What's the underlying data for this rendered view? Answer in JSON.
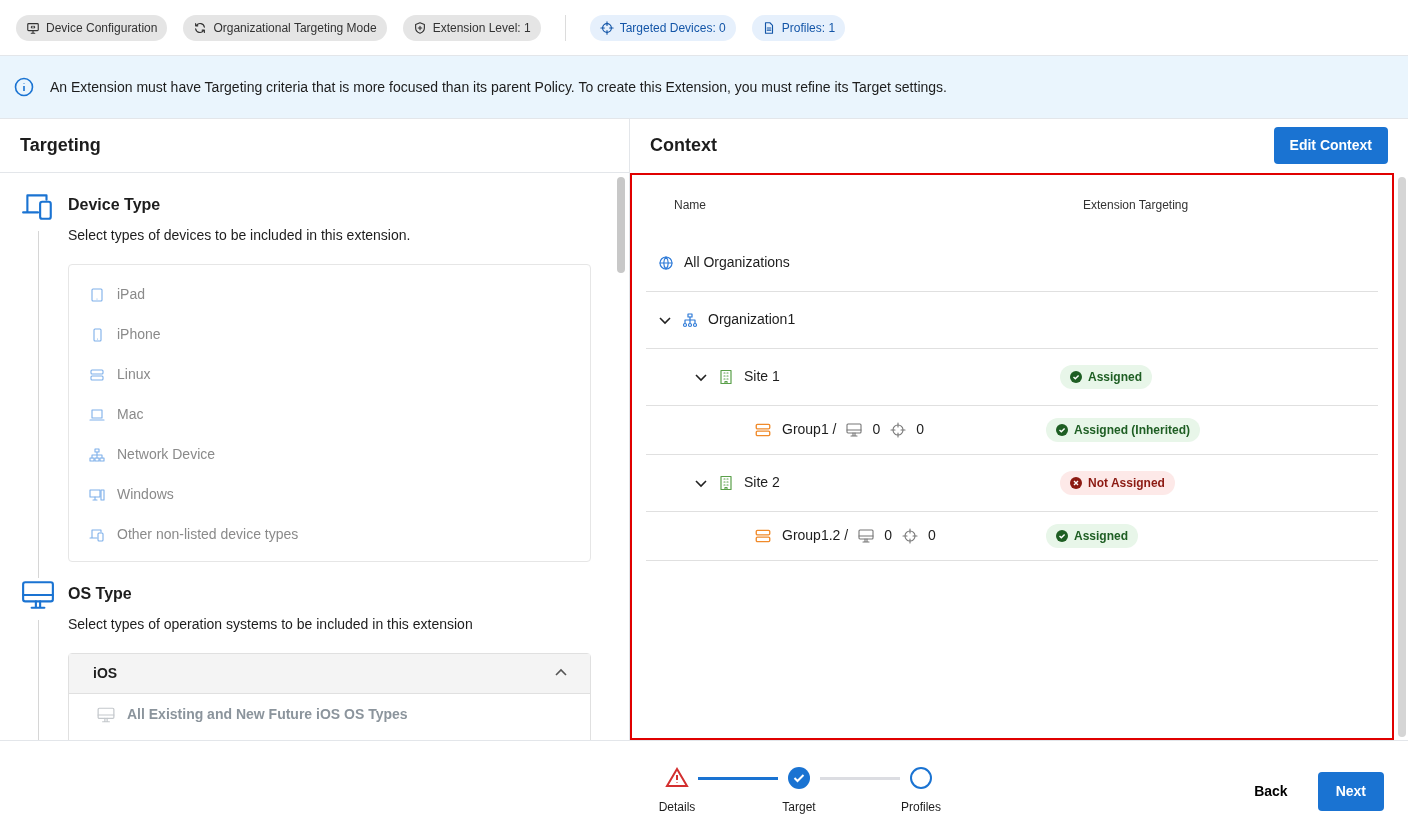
{
  "chips": [
    {
      "kind": "config",
      "color": "#e5e5e5",
      "label": "Device Configuration"
    },
    {
      "kind": "refresh",
      "color": "#e5e5e5",
      "label": "Organizational Targeting Mode"
    },
    {
      "kind": "shield",
      "color": "#e5e5e5",
      "label": "Extension Level: 1"
    },
    {
      "kind": "target",
      "color": "#e6f0fc",
      "label": "Targeted Devices: 0"
    },
    {
      "kind": "document",
      "color": "#e6f0fc",
      "label": "Profiles: 1"
    }
  ],
  "banner": {
    "text": "An Extension must have Targeting criteria that is more focused than its parent Policy. To create this Extension, you must refine its Target settings."
  },
  "targeting": {
    "title": "Targeting",
    "sections": [
      {
        "kind": "devices",
        "title": "Device Type",
        "description": "Select types of devices to be included in this extension.",
        "items": [
          {
            "kind": "tablet",
            "label": "iPad"
          },
          {
            "kind": "phone",
            "label": "iPhone"
          },
          {
            "kind": "server",
            "label": "Linux"
          },
          {
            "kind": "laptop",
            "label": "Mac"
          },
          {
            "kind": "network",
            "label": "Network Device"
          },
          {
            "kind": "desktop",
            "label": "Windows"
          },
          {
            "kind": "devices",
            "label": "Other non-listed device types"
          }
        ]
      },
      {
        "kind": "monitor",
        "title": "OS Type",
        "description": "Select types of operation systems to be included in this extension",
        "accordion": {
          "title": "iOS",
          "expanded": true,
          "items": [
            {
              "kind": "monitor",
              "label": "All Existing and New Future iOS OS Types"
            }
          ]
        }
      }
    ]
  },
  "context": {
    "title": "Context",
    "edit_button": "Edit Context",
    "columns": [
      "Name",
      "Extension Targeting"
    ],
    "tree": [
      {
        "kind": "globe",
        "name": "All Organizations"
      },
      {
        "kind": "organization",
        "name": "Organization1",
        "expanded": true,
        "children": [
          {
            "kind": "site",
            "name": "Site 1",
            "expanded": true,
            "status": {
              "kind": "assigned",
              "label": "Assigned"
            },
            "children": [
              {
                "kind": "group",
                "name": "Group1 /",
                "devices": "0",
                "targets": "0",
                "status": {
                  "kind": "assigned",
                  "label": "Assigned (Inherited)"
                }
              }
            ]
          },
          {
            "kind": "site",
            "name": "Site 2",
            "expanded": true,
            "status": {
              "kind": "not_assigned",
              "label": "Not Assigned"
            },
            "children": [
              {
                "kind": "group",
                "name": "Group1.2 /",
                "devices": "0",
                "targets": "0",
                "status": {
                  "kind": "assigned",
                  "label": "Assigned"
                }
              }
            ]
          }
        ]
      }
    ]
  },
  "steps": [
    {
      "kind": "error",
      "label": "Details"
    },
    {
      "kind": "done",
      "label": "Target"
    },
    {
      "kind": "pending",
      "label": "Profiles"
    }
  ],
  "footer": {
    "back": "Back",
    "next": "Next"
  }
}
